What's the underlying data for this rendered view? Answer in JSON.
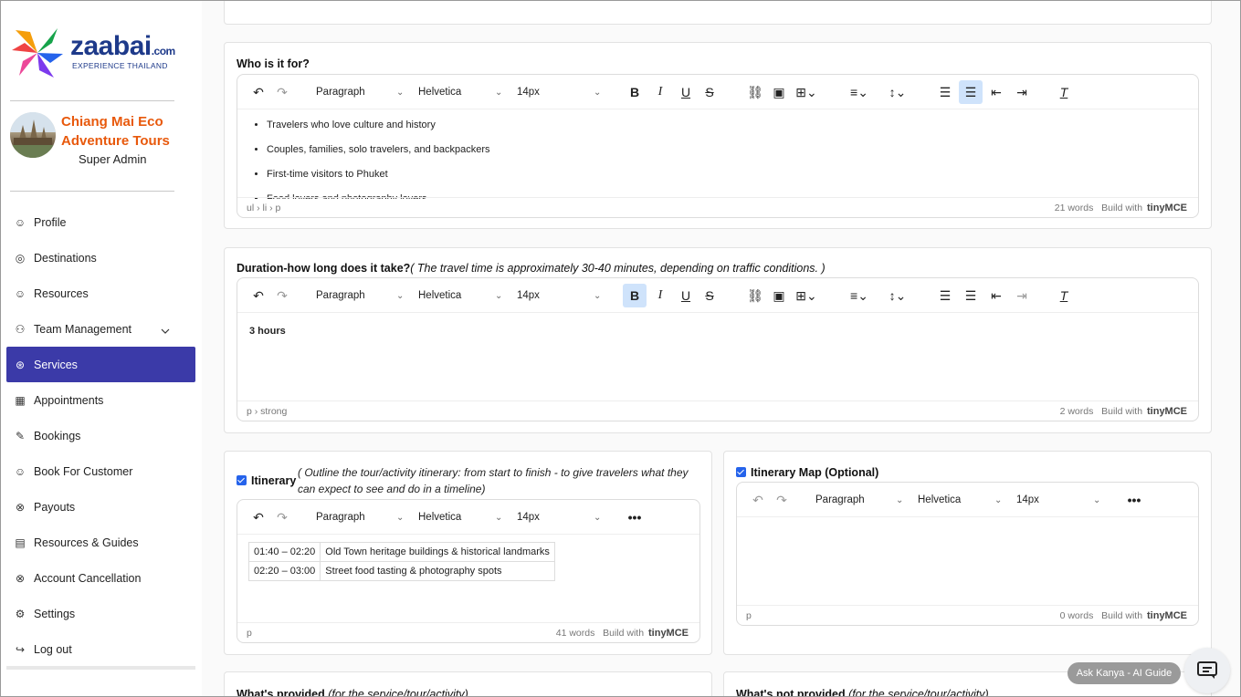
{
  "brand": {
    "name": "zaabai",
    "suffix": ".com",
    "tagline": "EXPERIENCE THAILAND"
  },
  "user": {
    "business_name": "Chiang Mai Eco Adventure Tours",
    "role": "Super Admin"
  },
  "nav": [
    {
      "label": "Profile",
      "icon": "person-icon"
    },
    {
      "label": "Destinations",
      "icon": "location-icon"
    },
    {
      "label": "Resources",
      "icon": "person-icon"
    },
    {
      "label": "Team Management",
      "icon": "team-icon"
    },
    {
      "label": "Services",
      "icon": "services-icon",
      "active": true
    },
    {
      "label": "Appointments",
      "icon": "calendar-icon"
    },
    {
      "label": "Bookings",
      "icon": "edit-icon"
    },
    {
      "label": "Book For Customer",
      "icon": "smile-icon"
    },
    {
      "label": "Payouts",
      "icon": "payout-icon"
    },
    {
      "label": "Resources & Guides",
      "icon": "guide-icon"
    },
    {
      "label": "Account Cancellation",
      "icon": "cancel-icon"
    },
    {
      "label": "Settings",
      "icon": "gear-icon"
    },
    {
      "label": "Log out",
      "icon": "logout-icon"
    }
  ],
  "toolbar": {
    "block": "Paragraph",
    "font": "Helvetica",
    "size": "14px"
  },
  "who": {
    "label": "Who is it for?",
    "items": [
      "Travelers who love culture and history",
      "Couples, families, solo travelers, and backpackers",
      "First-time visitors to Phuket",
      "Food lovers and photography lovers"
    ],
    "path": "ul › li › p",
    "words": "21 words"
  },
  "duration": {
    "label": "Duration-how long does it take?",
    "hint": "( The travel time is approximately 30-40 minutes, depending on traffic conditions. )",
    "value": "3 hours",
    "path": "p › strong",
    "words": "2 words"
  },
  "itinerary": {
    "label": "Itinerary",
    "hint": "( Outline the tour/activity itinerary: from start to finish - to give travelers what they can expect to see and do in a timeline)",
    "rows": [
      {
        "time": "01:40 – 02:20",
        "desc": "Old Town heritage buildings & historical landmarks"
      },
      {
        "time": "02:20 – 03:00",
        "desc": "Street food tasting & photography spots"
      }
    ],
    "path": "p",
    "words": "41 words"
  },
  "itinerary_map": {
    "label": "Itinerary Map (Optional)",
    "path": "p",
    "words": "0 words"
  },
  "provided": {
    "label": "What's provided",
    "hint": "(for the service/tour/activity)"
  },
  "not_provided": {
    "label": "What's not provided",
    "hint": "(for the service/tour/activity)"
  },
  "editor_brand": {
    "prefix": "Build with",
    "name": "tinyMCE"
  },
  "ai_guide": {
    "label": "Ask Kanya - AI Guide"
  }
}
